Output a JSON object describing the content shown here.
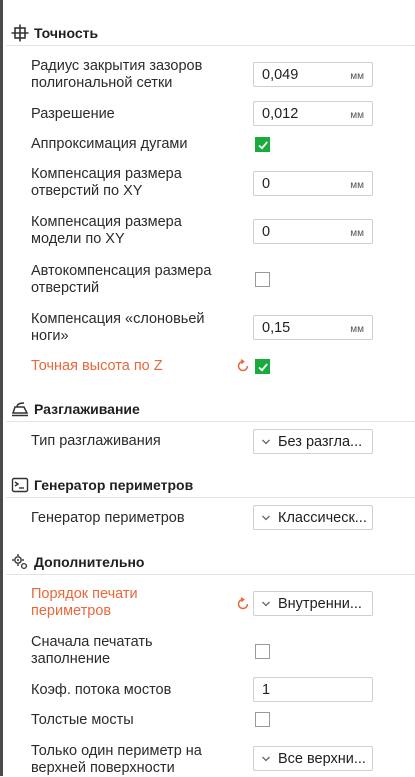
{
  "sections": {
    "precision": {
      "title": "Точность"
    },
    "ironing": {
      "title": "Разглаживание"
    },
    "perimeter_gen": {
      "title": "Генератор периметров"
    },
    "advanced": {
      "title": "Дополнительно"
    }
  },
  "precision": {
    "slice_closing_radius": {
      "label_l1": "Радиус закрытия зазоров",
      "label_l2": "полигональной сетки",
      "value": "0,049",
      "unit": "мм"
    },
    "resolution": {
      "label": "Разрешение",
      "value": "0,012",
      "unit": "мм"
    },
    "arc_fitting": {
      "label": "Аппроксимация дугами",
      "checked": true
    },
    "xy_hole_comp": {
      "label_l1": "Компенсация размера",
      "label_l2": "отверстий по XY",
      "value": "0",
      "unit": "мм"
    },
    "xy_contour_comp": {
      "label_l1": "Компенсация размера",
      "label_l2": "модели по XY",
      "value": "0",
      "unit": "мм"
    },
    "auto_hole_comp": {
      "label_l1": "Автокомпенсация размера",
      "label_l2": "отверстий",
      "checked": false
    },
    "elefant_foot": {
      "label_l1": "Компенсация «слоновьей",
      "label_l2": "ноги»",
      "value": "0,15",
      "unit": "мм"
    },
    "precise_z": {
      "label": "Точная высота по Z",
      "checked": true
    }
  },
  "ironing": {
    "type": {
      "label": "Тип разглаживания",
      "value": "Без разглаживания"
    }
  },
  "perimeter_gen": {
    "generator": {
      "label": "Генератор периметров",
      "value": "Классический"
    }
  },
  "advanced": {
    "wall_order": {
      "label_l1": "Порядок печати",
      "label_l2": "периметров",
      "value": "Внутренний/внешний"
    },
    "infill_first": {
      "label_l1": "Сначала печатать",
      "label_l2": "заполнение",
      "checked": false
    },
    "bridge_flow": {
      "label": "Коэф. потока мостов",
      "value": "1"
    },
    "thick_bridges": {
      "label": "Толстые мосты",
      "checked": false
    },
    "only_one_wall_top": {
      "label_l1": "Только один периметр на",
      "label_l2": "верхней поверхности",
      "value": "Все верхние поверхности"
    }
  },
  "colors": {
    "accent_green": "#1aab3e",
    "modified_orange": "#e8683b"
  }
}
